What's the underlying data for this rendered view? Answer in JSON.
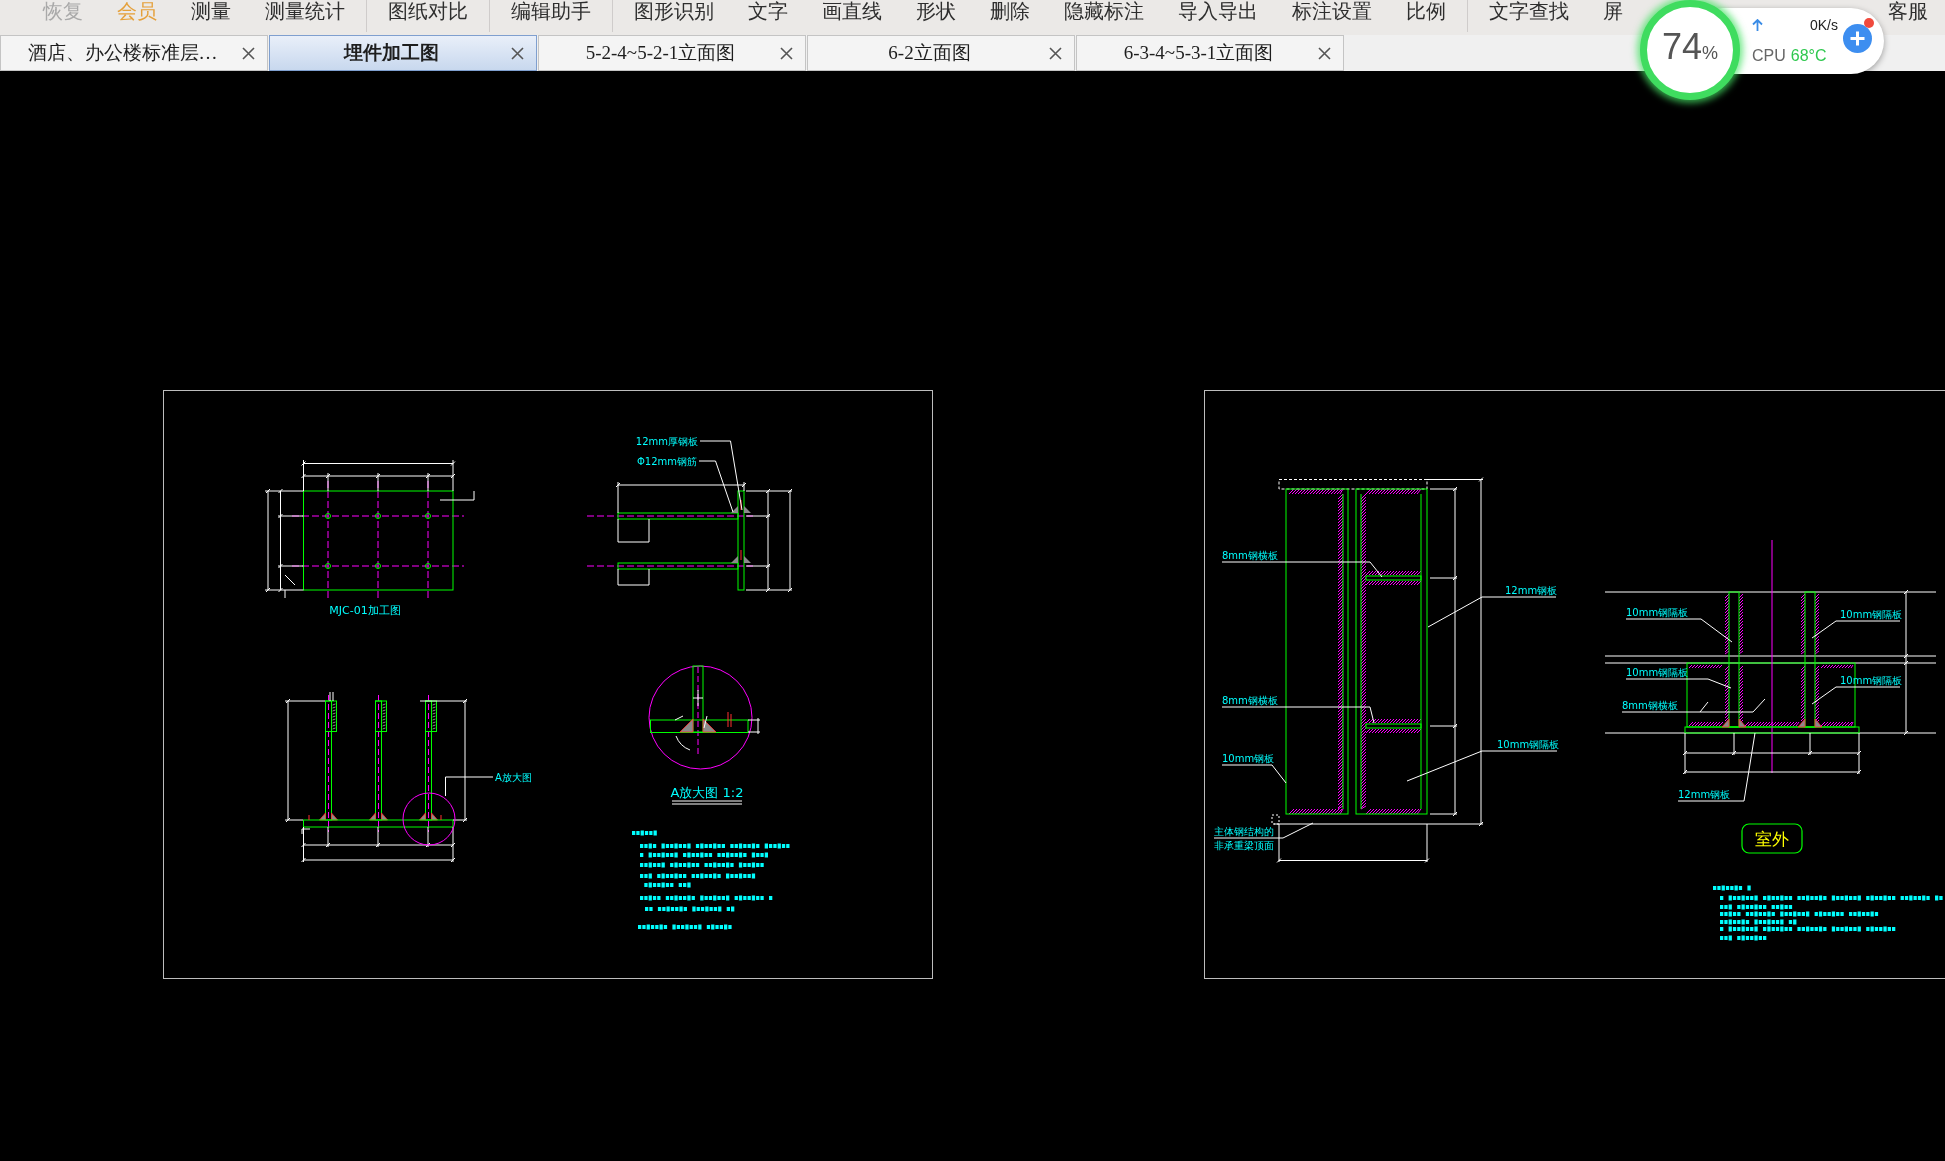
{
  "menu_bar": {
    "groups": [
      {
        "items": [
          {
            "label": "恢复",
            "highlighted": false,
            "disabled": true
          },
          {
            "label": "会员",
            "highlighted": true,
            "disabled": false
          },
          {
            "label": "测量",
            "highlighted": false,
            "disabled": false
          },
          {
            "label": "测量统计",
            "highlighted": false,
            "disabled": false
          }
        ]
      },
      {
        "items": [
          {
            "label": "图纸对比",
            "highlighted": false,
            "disabled": false
          }
        ]
      },
      {
        "items": [
          {
            "label": "编辑助手",
            "highlighted": false,
            "disabled": false
          }
        ]
      },
      {
        "items": [
          {
            "label": "图形识别",
            "highlighted": false,
            "disabled": false
          },
          {
            "label": "文字",
            "highlighted": false,
            "disabled": false
          },
          {
            "label": "画直线",
            "highlighted": false,
            "disabled": false
          },
          {
            "label": "形状",
            "highlighted": false,
            "disabled": false
          },
          {
            "label": "删除",
            "highlighted": false,
            "disabled": false
          },
          {
            "label": "隐藏标注",
            "highlighted": false,
            "disabled": false
          },
          {
            "label": "导入导出",
            "highlighted": false,
            "disabled": false
          },
          {
            "label": "标注设置",
            "highlighted": false,
            "disabled": false
          },
          {
            "label": "比例",
            "highlighted": false,
            "disabled": false
          }
        ]
      },
      {
        "items": [
          {
            "label": "文字查找",
            "highlighted": false,
            "disabled": false
          },
          {
            "label": "屏",
            "highlighted": false,
            "disabled": false
          }
        ]
      }
    ],
    "right_items": [
      {
        "label": "客服",
        "highlighted": false,
        "disabled": false
      }
    ]
  },
  "tabs": [
    {
      "label": "酒店、办公楼标准层…",
      "selected": false
    },
    {
      "label": "埋件加工图",
      "selected": true
    },
    {
      "label": "5-2-4~5-2-1立面图",
      "selected": false
    },
    {
      "label": "6-2立面图",
      "selected": false
    },
    {
      "label": "6-3-4~5-3-1立面图",
      "selected": false
    }
  ],
  "system_monitor": {
    "usage_value": "74",
    "usage_unit": "%",
    "network_speed": "0K/s",
    "cpu_label": "CPU",
    "cpu_temperature": "68°C",
    "notification": true
  },
  "canvas": {
    "sheets": [
      {
        "titles": [
          "MJC-01加工图",
          "A放大图 1:2"
        ],
        "callouts": [
          {
            "lines": [
              "12mm厚钢板"
            ]
          },
          {
            "lines": [
              "Φ12mm钢筋"
            ]
          },
          {
            "lines": [
              "A放大图"
            ]
          }
        ]
      },
      {
        "callouts": [
          {
            "lines": [
              "8mm钢横板"
            ]
          },
          {
            "lines": [
              "12mm钢板"
            ]
          },
          {
            "lines": [
              "8mm钢横板"
            ]
          },
          {
            "lines": [
              "10mm钢隔板"
            ]
          },
          {
            "lines": [
              "10mm钢板"
            ]
          },
          {
            "lines": [
              "主体钢结构的",
              "非承重梁顶面"
            ]
          },
          {
            "lines": [
              "10mm钢隔板"
            ]
          },
          {
            "lines": [
              "10mm钢隔板"
            ]
          },
          {
            "lines": [
              "10mm钢隔板"
            ]
          },
          {
            "lines": [
              "10mm钢隔板"
            ]
          },
          {
            "lines": [
              "8mm钢横板"
            ]
          },
          {
            "lines": [
              "12mm钢板"
            ]
          }
        ],
        "tag": "室外"
      }
    ]
  }
}
